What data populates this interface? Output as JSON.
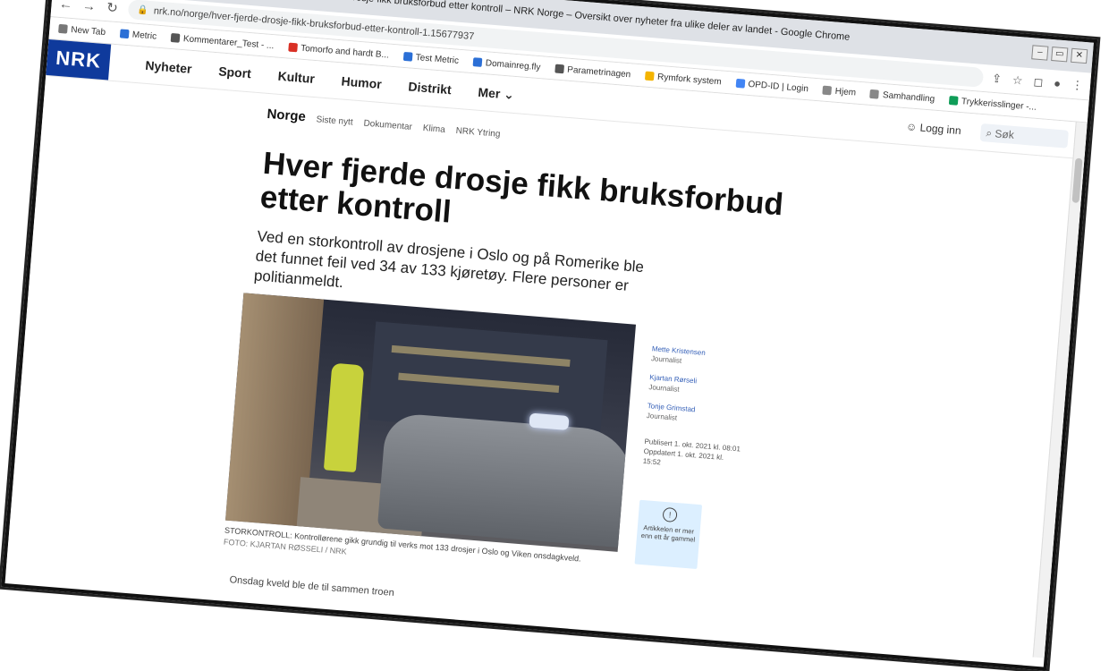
{
  "window": {
    "title": "Hver fjerde drosje fikk bruksforbud etter kontroll – NRK Norge – Oversikt over nyheter fra ulike deler av landet - Google Chrome",
    "controls": [
      "–",
      "▭",
      "✕"
    ]
  },
  "toolbar": {
    "url": "nrk.no/norge/hver-fjerde-drosje-fikk-bruksforbud-etter-kontroll-1.15677937",
    "icons": [
      "back-icon",
      "forward-icon",
      "reload-icon",
      "lock-icon",
      "share-icon",
      "star-icon",
      "extensions-icon",
      "profile-icon",
      "menu-icon"
    ]
  },
  "bookmarks": [
    {
      "label": "New Tab",
      "color": "#777777"
    },
    {
      "label": "Metric",
      "color": "#2b6fd6"
    },
    {
      "label": "Kommentarer_Test - ...",
      "color": "#555555"
    },
    {
      "label": "Tomorfo and hardt B...",
      "color": "#d93025"
    },
    {
      "label": "Test Metric",
      "color": "#2b6fd6"
    },
    {
      "label": "Domainreg.fly",
      "color": "#2b6fd6"
    },
    {
      "label": "Parametrinagen",
      "color": "#555555"
    },
    {
      "label": "Rymfork system",
      "color": "#f4b400"
    },
    {
      "label": "OPD-ID | Login",
      "color": "#4285f4"
    },
    {
      "label": "Hjem",
      "color": "#888888"
    },
    {
      "label": "Samhandling",
      "color": "#888888"
    },
    {
      "label": "Trykkerisslinger -...",
      "color": "#0f9d58"
    }
  ],
  "nrk": {
    "logo": "NRK",
    "nav": [
      "Nyheter",
      "Sport",
      "Kultur",
      "Humor",
      "Distrikt",
      "Mer ⌄"
    ],
    "login": "Logg inn",
    "search": "Søk",
    "section": "Norge",
    "subnav": [
      "Siste nytt",
      "Dokumentar",
      "Klima",
      "NRK Ytring"
    ]
  },
  "article": {
    "headline": "Hver fjerde drosje fikk bruksforbud etter kontroll",
    "lede": "Ved en storkontroll av drosjene i Oslo og på Romerike ble det funnet feil ved 34 av 133 kjøretøy. Flere personer er politianmeldt.",
    "caption": "STORKONTROLL: Kontrollørene gikk grundig til verks mot 133 drosjer i Oslo og Viken onsdagkveld.",
    "credit": "FOTO: KJARTAN RØSSELI / NRK",
    "authors": [
      {
        "name": "Mette Kristensen",
        "role": "Journalist"
      },
      {
        "name": "Kjartan Rørseli",
        "role": "Journalist"
      },
      {
        "name": "Tonje Grimstad",
        "role": "Journalist"
      }
    ],
    "published": "Publisert 1. okt. 2021 kl. 08:01",
    "updated": "Oppdatert 1. okt. 2021 kl. 15:52",
    "notice": "Artikkelen er mer enn ett år gammel",
    "body_start": "Onsdag kveld ble de til sammen troen"
  }
}
